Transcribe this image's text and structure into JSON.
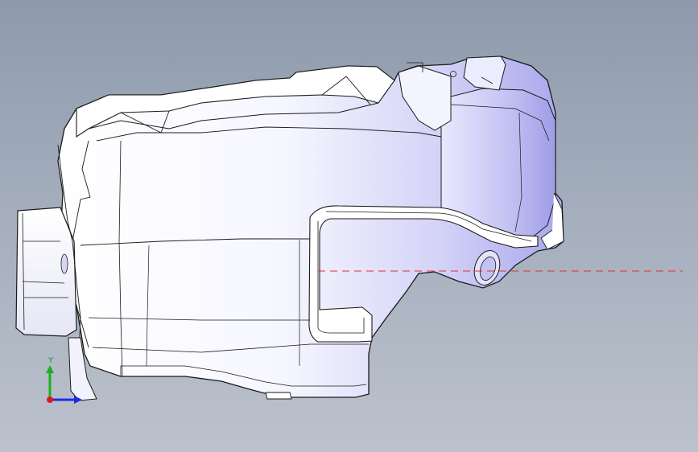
{
  "viewport": {
    "triad": {
      "y_label": "Y",
      "x_color": "#1a2ee0",
      "y_color": "#19b01c",
      "z_color": "#d81a1a"
    },
    "model": {
      "name": "plastic-tank-part",
      "face_color": "#ffffff",
      "shade_color": "#b9b8f2",
      "edge_color": "#1a1a1a"
    },
    "section_line_color": "#e0302a"
  }
}
